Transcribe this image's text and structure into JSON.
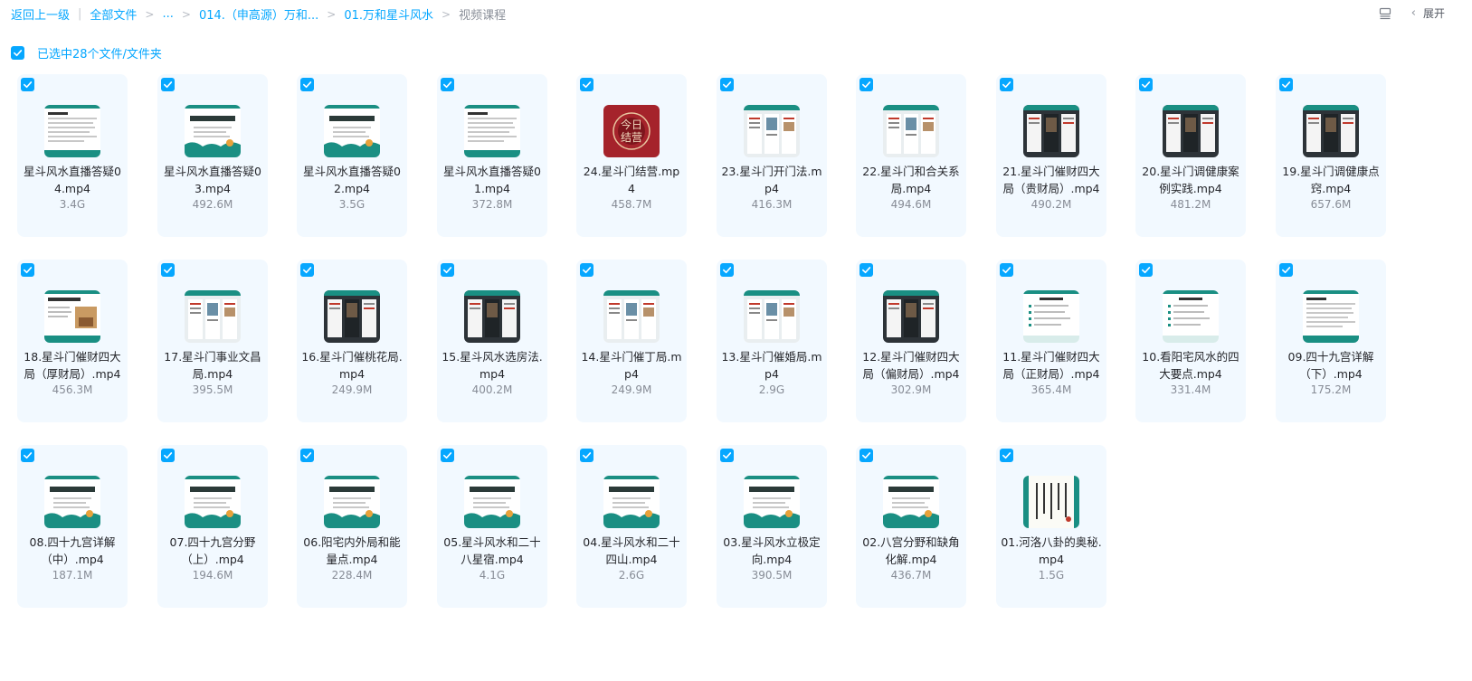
{
  "breadcrumb": {
    "back": "返回上一级",
    "divider": "|",
    "items": [
      "全部文件",
      "...",
      "014.（申高源）万和...",
      "01.万和星斗风水"
    ],
    "current": "视频课程",
    "separator": ">"
  },
  "toolbar": {
    "expand_label": "展开",
    "chevron": "‹"
  },
  "selection": {
    "label": "已选中28个文件/文件夹"
  },
  "colors": {
    "accent": "#06a7ff",
    "card_bg": "#f2f9ff",
    "teal": "#1a8f83"
  },
  "files": [
    {
      "name": "星斗风水直播答疑04.mp4",
      "size": "3.4G",
      "thumb": "doc-a"
    },
    {
      "name": "星斗风水直播答疑03.mp4",
      "size": "492.6M",
      "thumb": "banner"
    },
    {
      "name": "星斗风水直播答疑02.mp4",
      "size": "3.5G",
      "thumb": "banner"
    },
    {
      "name": "星斗风水直播答疑01.mp4",
      "size": "372.8M",
      "thumb": "doc-a"
    },
    {
      "name": "24.星斗门结营.mp4",
      "size": "458.7M",
      "thumb": "red",
      "logo_text": "今日结营"
    },
    {
      "name": "23.星斗门开门法.mp4",
      "size": "416.3M",
      "thumb": "multi"
    },
    {
      "name": "22.星斗门和合关系局.mp4",
      "size": "494.6M",
      "thumb": "multi"
    },
    {
      "name": "21.星斗门催财四大局（贵财局）.mp4",
      "size": "490.2M",
      "thumb": "dark"
    },
    {
      "name": "20.星斗门调健康案例实践.mp4",
      "size": "481.2M",
      "thumb": "dark"
    },
    {
      "name": "19.星斗门调健康点窍.mp4",
      "size": "657.6M",
      "thumb": "dark"
    },
    {
      "name": "18.星斗门催财四大局（厚财局）.mp4",
      "size": "456.3M",
      "thumb": "room"
    },
    {
      "name": "17.星斗门事业文昌局.mp4",
      "size": "395.5M",
      "thumb": "multi"
    },
    {
      "name": "16.星斗门催桃花局.mp4",
      "size": "249.9M",
      "thumb": "dark"
    },
    {
      "name": "15.星斗风水选房法.mp4",
      "size": "400.2M",
      "thumb": "dark"
    },
    {
      "name": "14.星斗门催丁局.mp4",
      "size": "249.9M",
      "thumb": "multi"
    },
    {
      "name": "13.星斗门催婚局.mp4",
      "size": "2.9G",
      "thumb": "multi"
    },
    {
      "name": "12.星斗门催财四大局（偏财局）.mp4",
      "size": "302.9M",
      "thumb": "dark"
    },
    {
      "name": "11.星斗门催财四大局（正财局）.mp4",
      "size": "365.4M",
      "thumb": "doc-b"
    },
    {
      "name": "10.看阳宅风水的四大要点.mp4",
      "size": "331.4M",
      "thumb": "doc-b"
    },
    {
      "name": "09.四十九宫详解（下）.mp4",
      "size": "175.2M",
      "thumb": "doc-a"
    },
    {
      "name": "08.四十九宫详解（中）.mp4",
      "size": "187.1M",
      "thumb": "banner"
    },
    {
      "name": "07.四十九宫分野（上）.mp4",
      "size": "194.6M",
      "thumb": "banner"
    },
    {
      "name": "06.阳宅内外局和能量点.mp4",
      "size": "228.4M",
      "thumb": "banner"
    },
    {
      "name": "05.星斗风水和二十八星宿.mp4",
      "size": "4.1G",
      "thumb": "banner"
    },
    {
      "name": "04.星斗风水和二十四山.mp4",
      "size": "2.6G",
      "thumb": "banner"
    },
    {
      "name": "03.星斗风水立极定向.mp4",
      "size": "390.5M",
      "thumb": "banner"
    },
    {
      "name": "02.八宫分野和缺角化解.mp4",
      "size": "436.7M",
      "thumb": "banner"
    },
    {
      "name": "01.河洛八卦的奥秘.mp4",
      "size": "1.5G",
      "thumb": "scroll"
    }
  ]
}
